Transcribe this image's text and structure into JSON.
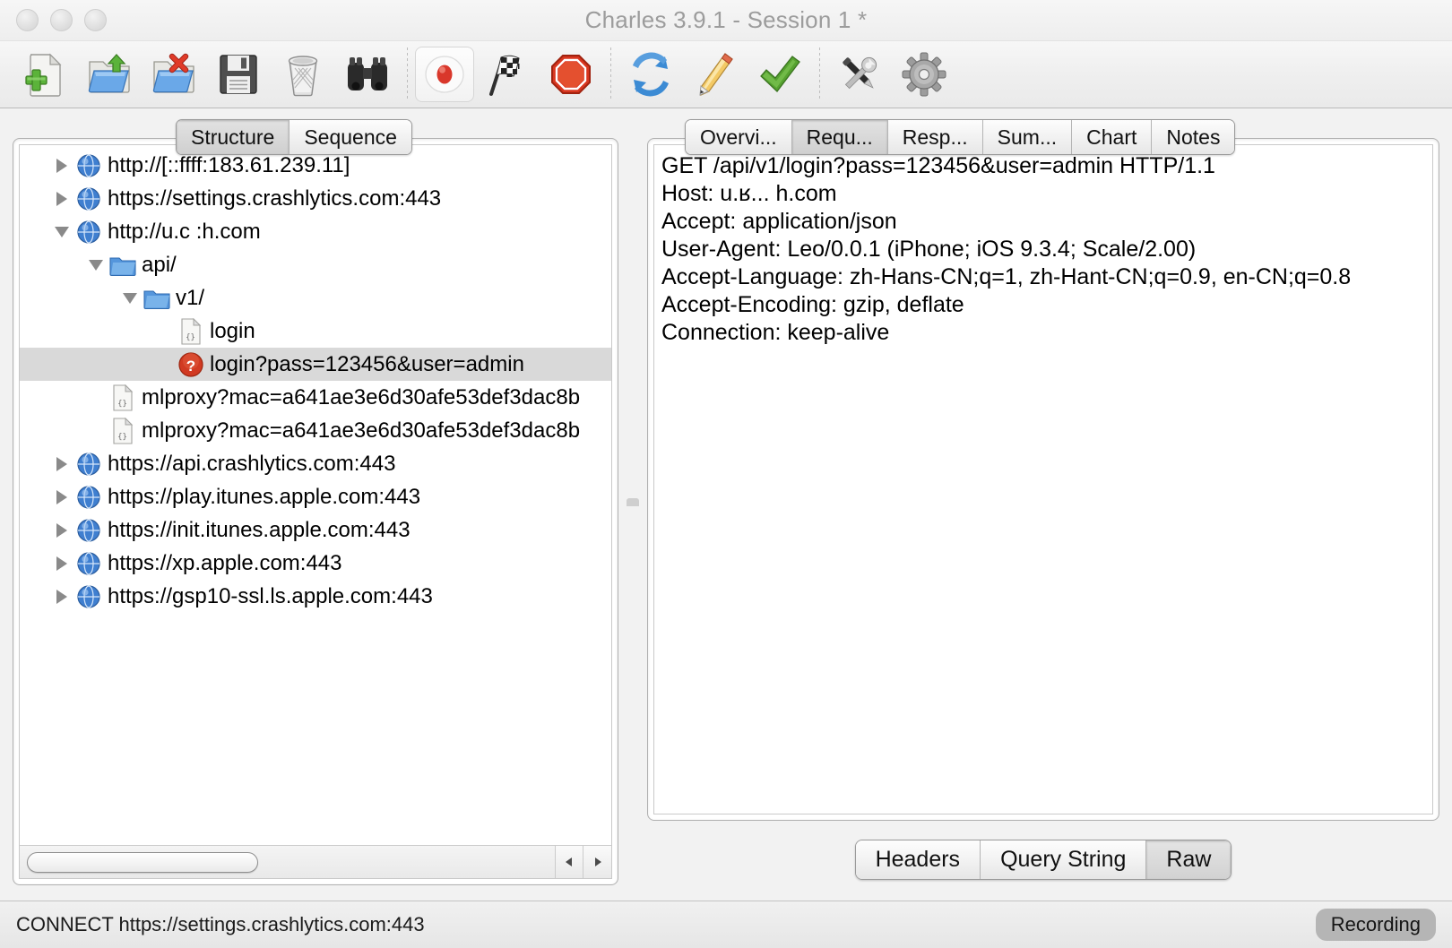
{
  "window": {
    "title": "Charles 3.9.1 - Session 1 *",
    "buttons": [
      "close",
      "minimize",
      "zoom"
    ]
  },
  "toolbar": {
    "items": [
      {
        "name": "new-session-icon",
        "label": "New Session"
      },
      {
        "name": "open-session-icon",
        "label": "Open Session"
      },
      {
        "name": "close-session-icon",
        "label": "Close Session"
      },
      {
        "name": "save-session-icon",
        "label": "Save Session"
      },
      {
        "name": "clear-session-icon",
        "label": "Clear Session"
      },
      {
        "name": "find-icon",
        "label": "Find"
      },
      {
        "name": "record-icon",
        "label": "Start/Stop Recording",
        "toggled": true
      },
      {
        "name": "throttle-flag-icon",
        "label": "Throttling"
      },
      {
        "name": "breakpoints-stop-icon",
        "label": "Breakpoints"
      },
      {
        "name": "repeat-icon",
        "label": "Repeat"
      },
      {
        "name": "compose-pencil-icon",
        "label": "Compose"
      },
      {
        "name": "validate-check-icon",
        "label": "Validate"
      },
      {
        "name": "tools-icon",
        "label": "Tools"
      },
      {
        "name": "settings-gear-icon",
        "label": "Settings"
      }
    ]
  },
  "left_pane": {
    "tabs": [
      {
        "label": "Structure",
        "selected": true
      },
      {
        "label": "Sequence",
        "selected": false
      }
    ],
    "tree": [
      {
        "label": "http://[::ffff:183.61.239.11]",
        "depth": 0,
        "twisty": "closed",
        "icon": "globe-icon",
        "selected": false
      },
      {
        "label": "https://settings.crashlytics.com:443",
        "depth": 0,
        "twisty": "closed",
        "icon": "globe-icon",
        "selected": false
      },
      {
        "label": "http://u.c    :h.com",
        "depth": 0,
        "twisty": "open",
        "icon": "globe-icon",
        "selected": false
      },
      {
        "label": "api/",
        "depth": 1,
        "twisty": "open",
        "icon": "folder-icon",
        "selected": false
      },
      {
        "label": "v1/",
        "depth": 2,
        "twisty": "open",
        "icon": "folder-icon",
        "selected": false
      },
      {
        "label": "login",
        "depth": 3,
        "twisty": "none",
        "icon": "json-file-icon",
        "selected": false
      },
      {
        "label": "login?pass=123456&user=admin",
        "depth": 3,
        "twisty": "none",
        "icon": "error-icon",
        "selected": true
      },
      {
        "label": "mlproxy?mac=a641ae3e6d30afe53def3dac8b",
        "depth": 2,
        "twisty": "none",
        "icon": "json-file-icon",
        "selected": false
      },
      {
        "label": "mlproxy?mac=a641ae3e6d30afe53def3dac8b",
        "depth": 2,
        "twisty": "none",
        "icon": "json-file-icon",
        "selected": false
      },
      {
        "label": "https://api.crashlytics.com:443",
        "depth": 0,
        "twisty": "closed",
        "icon": "globe-icon",
        "selected": false
      },
      {
        "label": "https://play.itunes.apple.com:443",
        "depth": 0,
        "twisty": "closed",
        "icon": "globe-icon",
        "selected": false
      },
      {
        "label": "https://init.itunes.apple.com:443",
        "depth": 0,
        "twisty": "closed",
        "icon": "globe-icon",
        "selected": false
      },
      {
        "label": "https://xp.apple.com:443",
        "depth": 0,
        "twisty": "closed",
        "icon": "globe-icon",
        "selected": false
      },
      {
        "label": "https://gsp10-ssl.ls.apple.com:443",
        "depth": 0,
        "twisty": "closed",
        "icon": "globe-icon",
        "selected": false
      }
    ],
    "scrollbar": {
      "left_arrow": "◀",
      "right_arrow": "▶"
    }
  },
  "right_pane": {
    "tabs": [
      {
        "label": "Overvi...",
        "selected": false
      },
      {
        "label": "Requ...",
        "selected": true
      },
      {
        "label": "Resp...",
        "selected": false
      },
      {
        "label": "Sum...",
        "selected": false
      },
      {
        "label": "Chart",
        "selected": false
      },
      {
        "label": "Notes",
        "selected": false
      }
    ],
    "request_raw": [
      "GET /api/v1/login?pass=123456&user=admin HTTP/1.1",
      "Host: u.ʁ... h.com",
      "Accept: application/json",
      "User-Agent: Leo/0.0.1 (iPhone; iOS 9.3.4; Scale/2.00)",
      "Accept-Language: zh-Hans-CN;q=1, zh-Hant-CN;q=0.9, en-CN;q=0.8",
      "Accept-Encoding: gzip, deflate",
      "Connection: keep-alive"
    ],
    "view_modes": [
      {
        "label": "Headers",
        "selected": false
      },
      {
        "label": "Query String",
        "selected": false
      },
      {
        "label": "Raw",
        "selected": true
      }
    ]
  },
  "status_bar": {
    "message": "CONNECT https://settings.crashlytics.com:443",
    "recording_badge": "Recording"
  },
  "colors": {
    "accent_red": "#d9372b",
    "selection_grey": "#d9d9d9",
    "window_chrome": "#f2f2f2",
    "title_text": "#9c9c9c"
  }
}
